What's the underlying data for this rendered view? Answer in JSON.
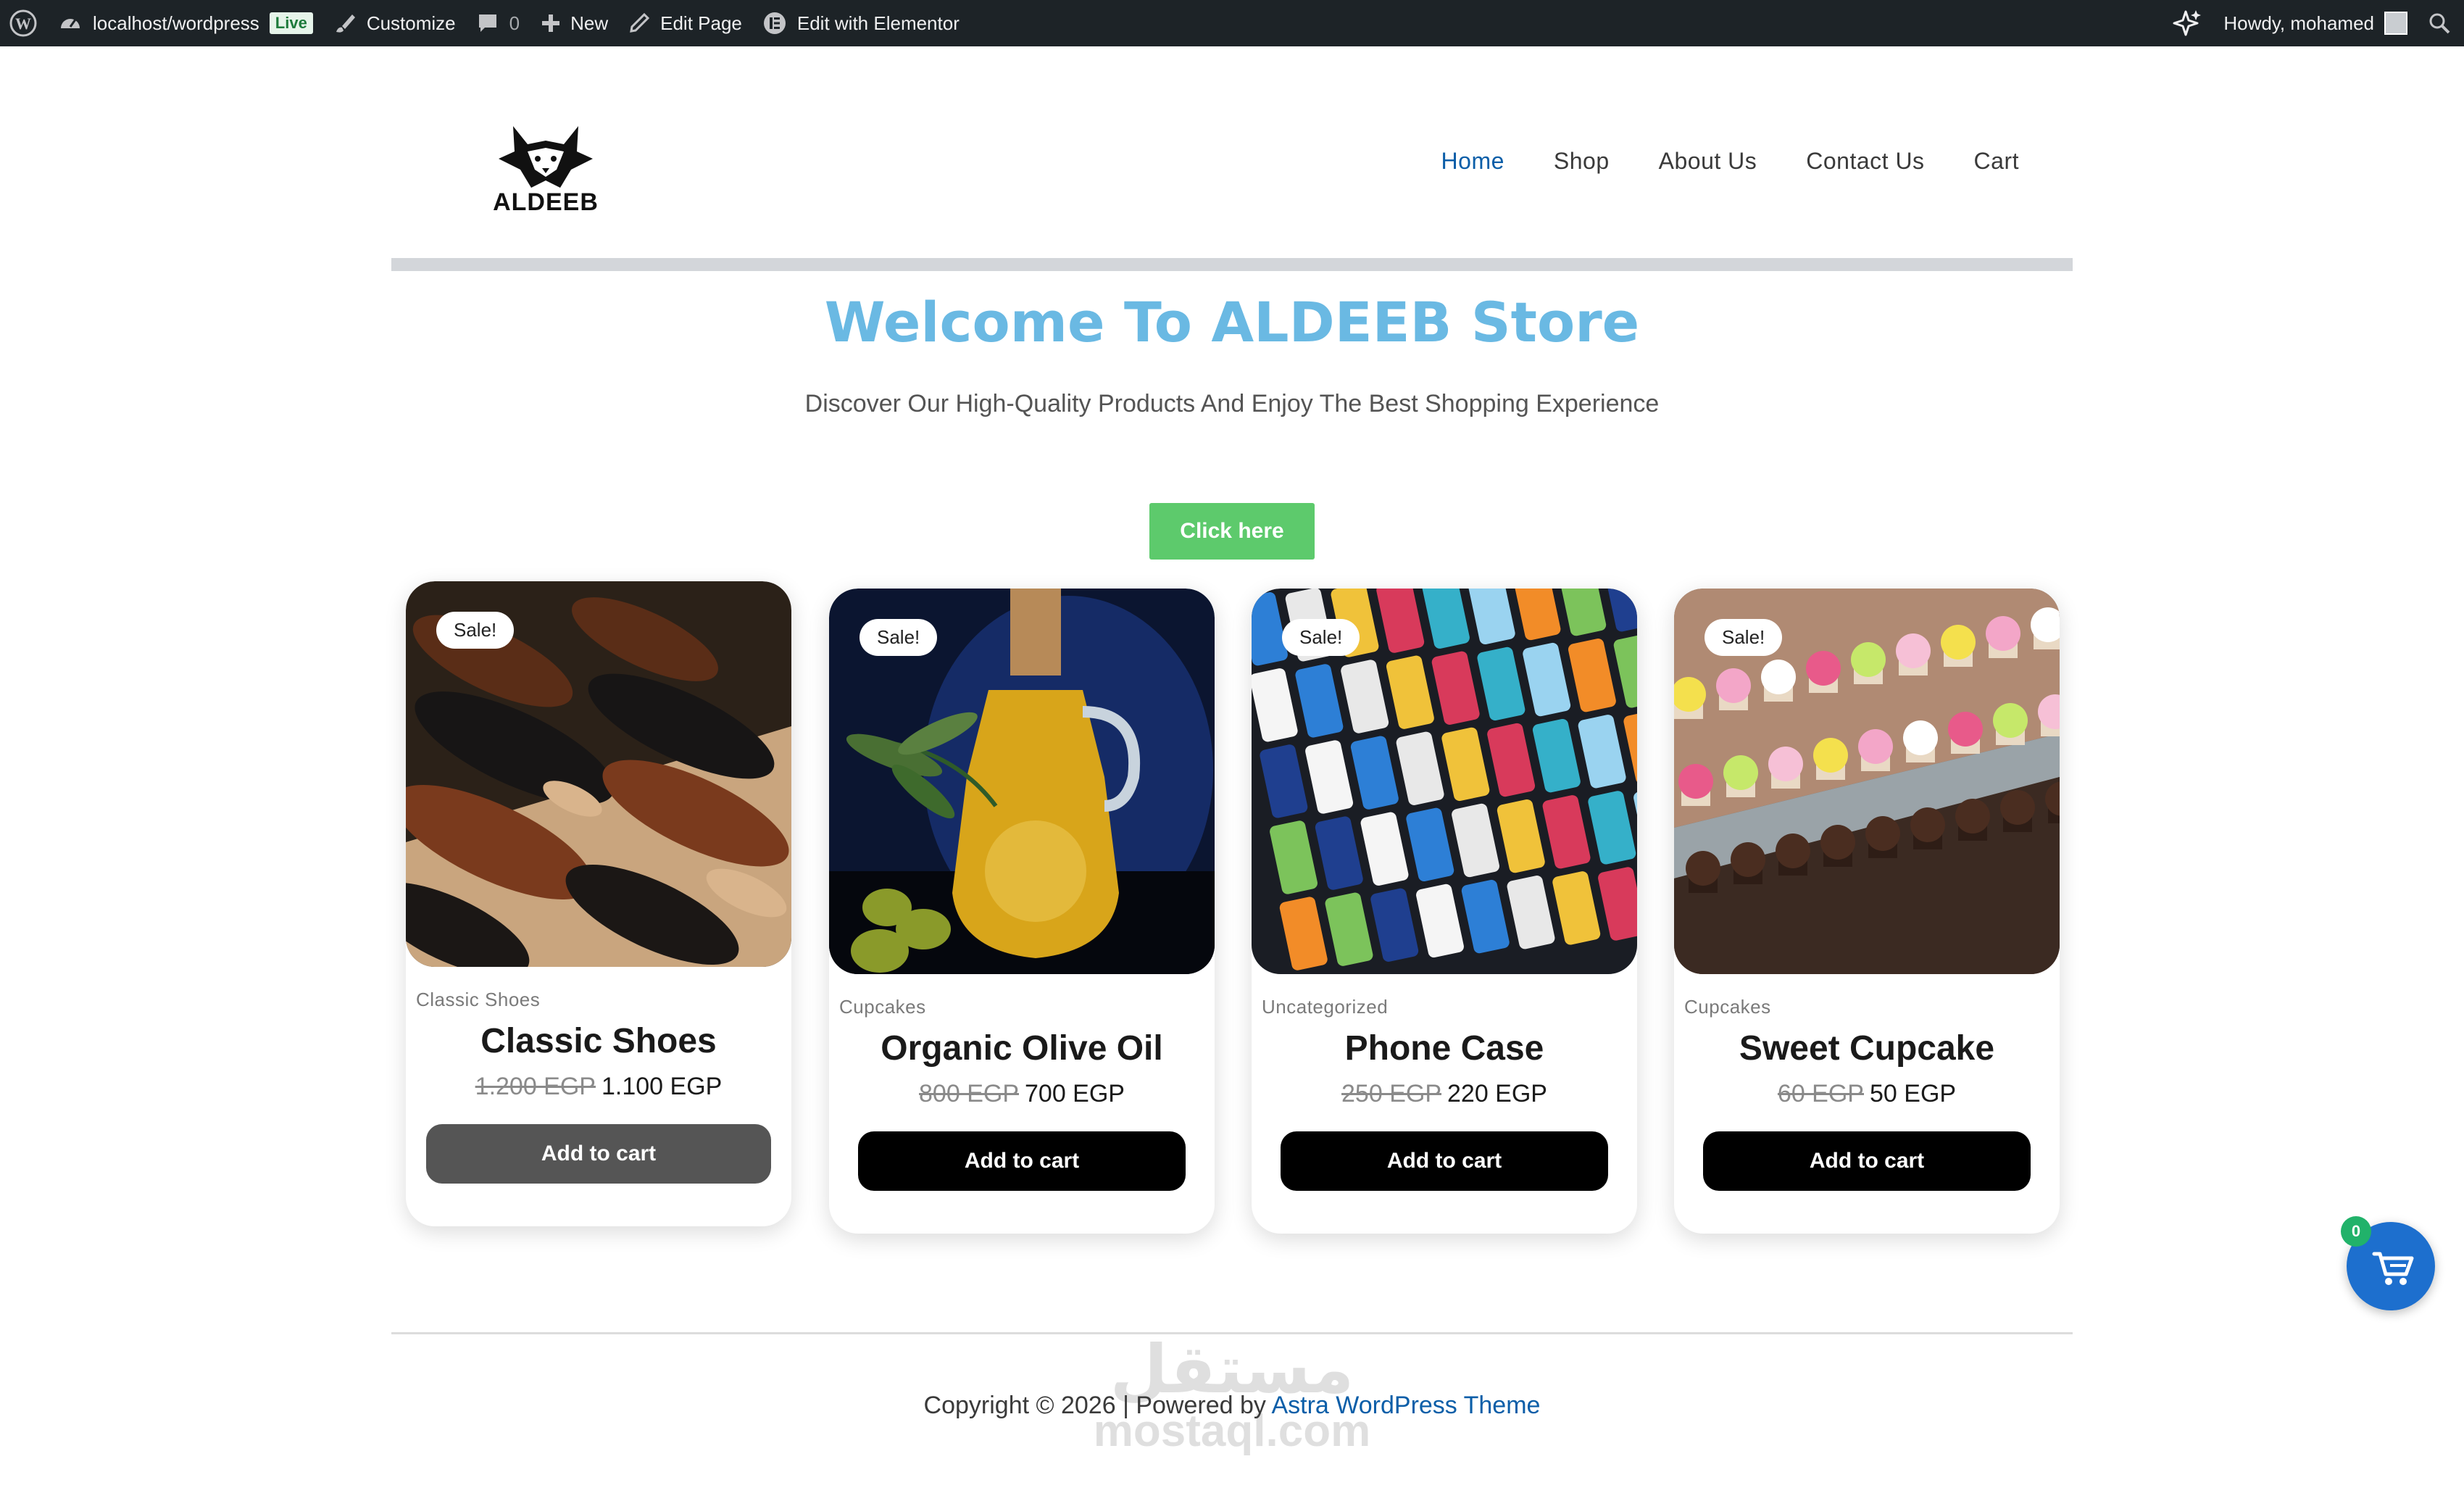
{
  "admin_bar": {
    "site_name": "localhost/wordpress",
    "live_badge": "Live",
    "customize": "Customize",
    "comments_count": "0",
    "new": "New",
    "edit_page": "Edit Page",
    "edit_elementor": "Edit with Elementor",
    "howdy": "Howdy, mohamed"
  },
  "header": {
    "logo_text": "ALDEEB",
    "nav": [
      "Home",
      "Shop",
      "About Us",
      "Contact Us",
      "Cart"
    ],
    "active_nav": "Home"
  },
  "hero": {
    "title": "Welcome To ALDEEB Store",
    "subtitle": "Discover Our High-Quality Products And Enjoy The Best Shopping Experience",
    "button": "Click here"
  },
  "products": [
    {
      "sale": "Sale!",
      "category": "Classic Shoes",
      "title": "Classic Shoes",
      "old_price": "1.200 EGP",
      "price": "1.100 EGP",
      "button": "Add to cart"
    },
    {
      "sale": "Sale!",
      "category": "Cupcakes",
      "title": "Organic Olive Oil",
      "old_price": "800 EGP",
      "price": "700 EGP",
      "button": "Add to cart"
    },
    {
      "sale": "Sale!",
      "category": "Uncategorized",
      "title": "Phone Case",
      "old_price": "250 EGP",
      "price": "220 EGP",
      "button": "Add to cart"
    },
    {
      "sale": "Sale!",
      "category": "Cupcakes",
      "title": "Sweet Cupcake",
      "old_price": "60 EGP",
      "price": "50 EGP",
      "button": "Add to cart"
    }
  ],
  "footer": {
    "copyright": "Copyright © 2026 | Powered by ",
    "theme_link": "Astra WordPress Theme"
  },
  "watermark": {
    "arabic": "مستقل",
    "latin": "mostaql.com"
  },
  "floating_cart": {
    "count": "0"
  },
  "colors": {
    "accent_blue": "#0b5ea8",
    "hero_title": "#6ab9e3",
    "hero_button": "#5dca6c",
    "admin_bar": "#1d2327"
  }
}
